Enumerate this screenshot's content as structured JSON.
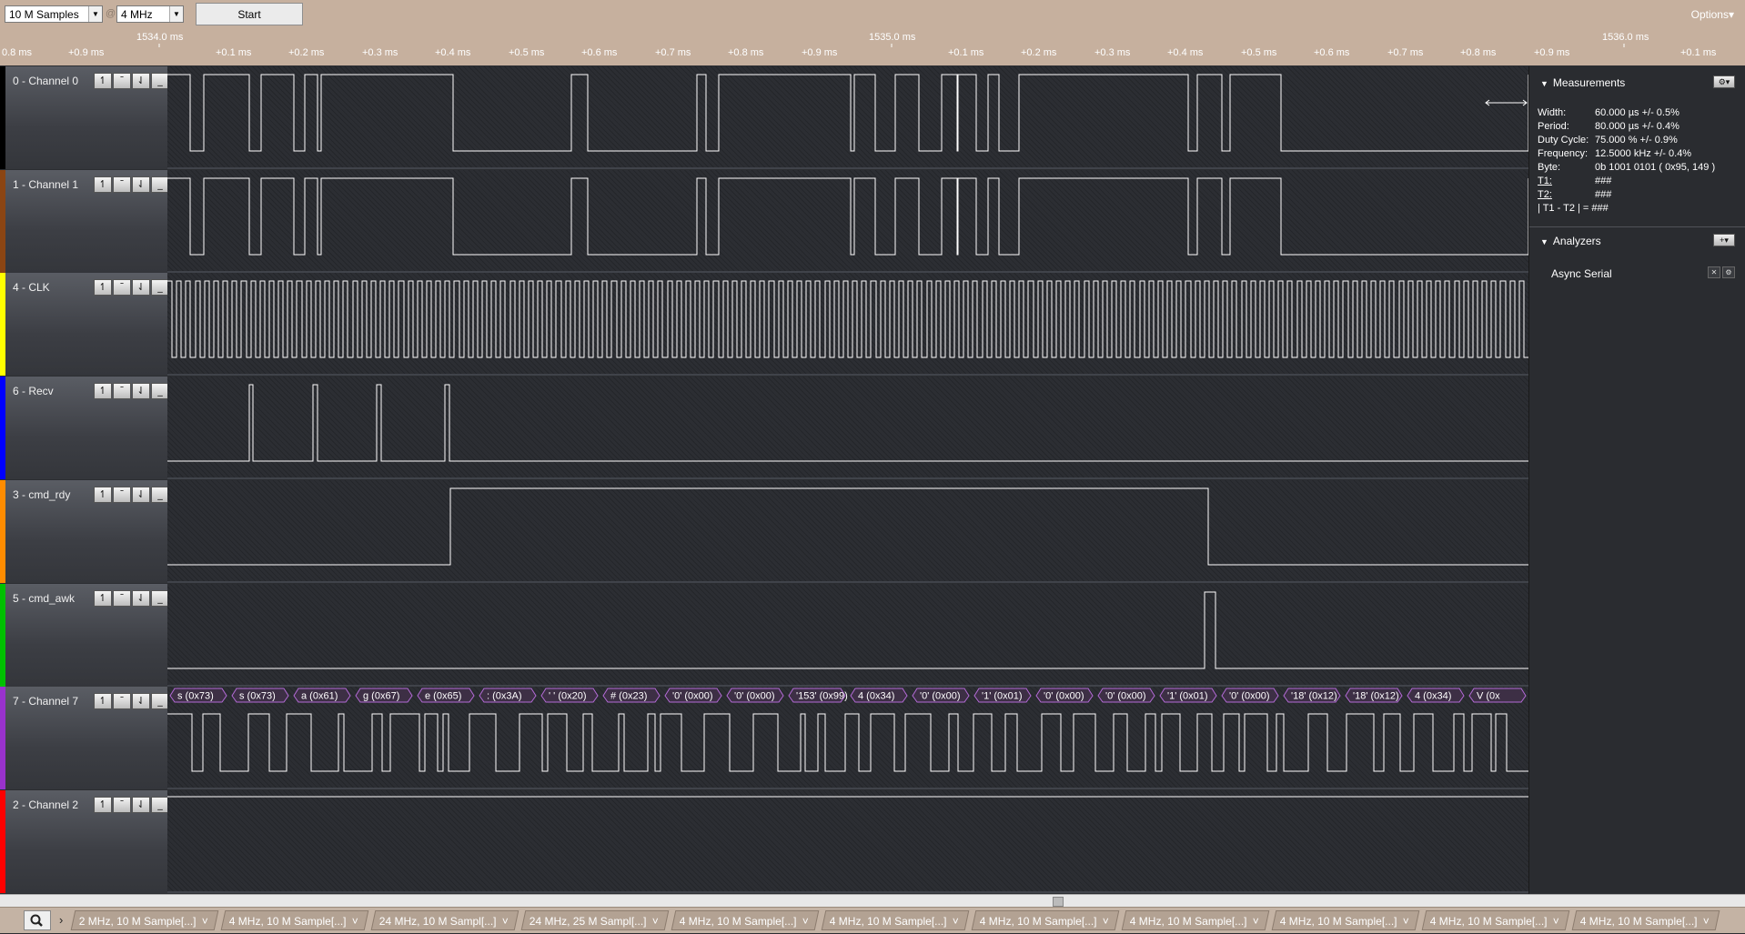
{
  "toolbar": {
    "samples_select": "10 M Samples",
    "at_label": "@",
    "rate_select": "4 MHz",
    "start_label": "Start",
    "options_label": "Options▾"
  },
  "ruler": {
    "anchors": [
      "1534.0 ms",
      "1535.0 ms",
      "1536.0 ms"
    ],
    "ticks": [
      "0.8 ms",
      "+0.9 ms",
      "+0.1 ms",
      "+0.2 ms",
      "+0.3 ms",
      "+0.4 ms",
      "+0.5 ms",
      "+0.6 ms",
      "+0.7 ms",
      "+0.8 ms",
      "+0.9 ms",
      "+0.1 ms",
      "+0.2 ms",
      "+0.3 ms",
      "+0.4 ms",
      "+0.5 ms",
      "+0.6 ms",
      "+0.7 ms",
      "+0.8 ms",
      "+0.9 ms",
      "+0.1 ms"
    ]
  },
  "channels": [
    {
      "name": "0 - Channel 0",
      "color": "#000000"
    },
    {
      "name": "1 - Channel 1",
      "color": "#8b4513"
    },
    {
      "name": "4 - CLK",
      "color": "#ffff00"
    },
    {
      "name": "6 - Recv",
      "color": "#0000ff"
    },
    {
      "name": "3 - cmd_rdy",
      "color": "#ff8c00"
    },
    {
      "name": "5 - cmd_awk",
      "color": "#00c000"
    },
    {
      "name": "7 - Channel 7",
      "color": "#9932cc"
    },
    {
      "name": "2 - Channel 2",
      "color": "#ff0000"
    }
  ],
  "trigger_icons": [
    "rising-edge-icon",
    "high-level-icon",
    "falling-edge-icon",
    "low-level-icon"
  ],
  "serial_bytes": [
    "s (0x73)",
    "s (0x73)",
    "a (0x61)",
    "g (0x67)",
    "e (0x65)",
    ": (0x3A)",
    "' ' (0x20)",
    "# (0x23)",
    "'0' (0x00)",
    "'0' (0x00)",
    "'153' (0x99)",
    "4 (0x34)",
    "'0' (0x00)",
    "'1' (0x01)",
    "'0' (0x00)",
    "'0' (0x00)",
    "'1' (0x01)",
    "'0' (0x00)",
    "'18' (0x12)",
    "'18' (0x12)",
    "4 (0x34)",
    "V (0x"
  ],
  "measurements": {
    "title": "Measurements",
    "rows": [
      {
        "key": "Width:",
        "value": "60.000 µs +/- 0.5%"
      },
      {
        "key": "Period:",
        "value": "80.000 µs +/- 0.4%"
      },
      {
        "key": "Duty Cycle:",
        "value": "75.000 % +/- 0.9%"
      },
      {
        "key": "Frequency:",
        "value": "12.5000 kHz +/- 0.4%"
      },
      {
        "key": "Byte:",
        "value": "0b  1001  0101  ( 0x95, 149 )"
      },
      {
        "key": "T1:",
        "value": "###"
      },
      {
        "key": "T2:",
        "value": "###"
      },
      {
        "key": "| T1 - T2 | =",
        "value": "###"
      }
    ]
  },
  "analyzers": {
    "title": "Analyzers",
    "items": [
      "Async Serial"
    ]
  },
  "tabs": [
    "2 MHz, 10 M Sample[...]",
    "4 MHz, 10 M Sample[...]",
    "24 MHz, 10 M Sampl[...]",
    "24 MHz, 25 M Sampl[...]",
    "4 MHz, 10 M Sample[...]",
    "4 MHz, 10 M Sample[...]",
    "4 MHz, 10 M Sample[...]",
    "4 MHz, 10 M Sample[...]",
    "4 MHz, 10 M Sample[...]",
    "4 MHz, 10 M Sample[...]",
    "4 MHz, 10 M Sample[...]"
  ],
  "tab_arrow": "˅"
}
